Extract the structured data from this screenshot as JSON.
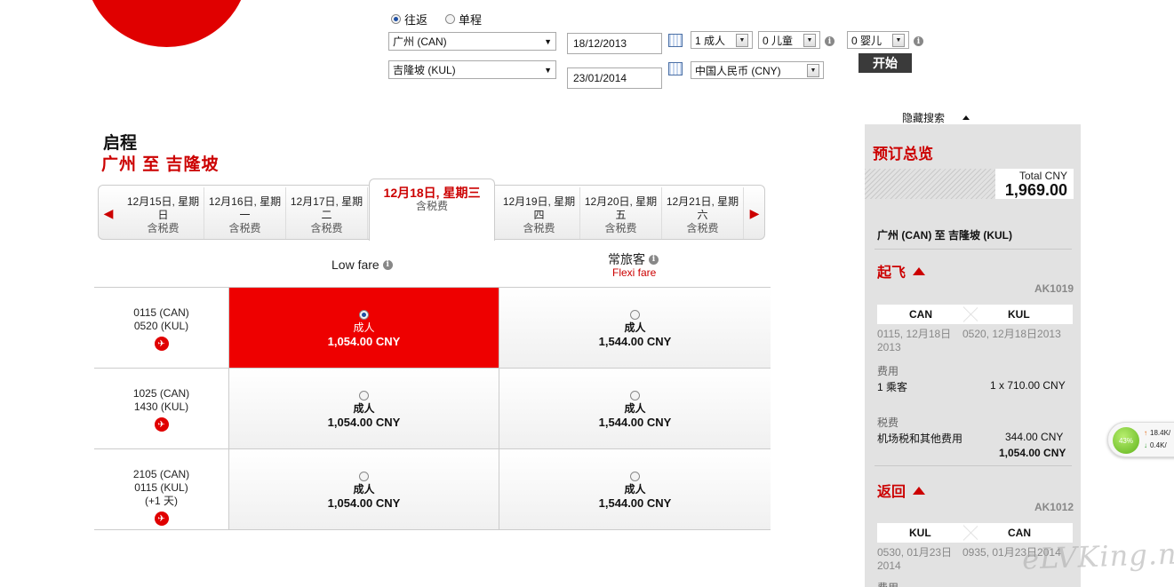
{
  "search": {
    "trip_types": [
      {
        "label": "往返",
        "selected": true
      },
      {
        "label": "单程",
        "selected": false
      }
    ],
    "origin": "广州 (CAN)",
    "destination": "吉隆坡 (KUL)",
    "depart_date": "18/12/2013",
    "return_date": "23/01/2014",
    "adults": "1 成人",
    "children": "0 儿童",
    "infants": "0 婴儿",
    "currency": "中国人民币 (CNY)",
    "go_label": "开始",
    "hide_search_label": "隐藏搜索"
  },
  "departure": {
    "heading": "启程",
    "route": "广州  至  吉隆坡",
    "date_tabs": [
      {
        "line1": "12月15日, 星期",
        "line2": "日",
        "sub": "含税费",
        "active": false
      },
      {
        "line1": "12月16日, 星期",
        "line2": "一",
        "sub": "含税费",
        "active": false
      },
      {
        "line1": "12月17日, 星期",
        "line2": "二",
        "sub": "含税费",
        "active": false
      },
      {
        "line1": "12月18日, 星期三",
        "line2": "",
        "sub": "含税费",
        "active": true
      },
      {
        "line1": "12月19日, 星期",
        "line2": "四",
        "sub": "含税费",
        "active": false
      },
      {
        "line1": "12月20日, 星期",
        "line2": "五",
        "sub": "含税费",
        "active": false
      },
      {
        "line1": "12月21日, 星期",
        "line2": "六",
        "sub": "含税费",
        "active": false
      }
    ],
    "fare_headers": {
      "low": "Low fare",
      "flexi": "常旅客",
      "flexi_sub": "Flexi fare"
    },
    "flights": [
      {
        "dep": "0115  (CAN)",
        "arr": "0520  (KUL)",
        "extra": "",
        "low_pax": "成人",
        "low_price": "1,054.00 CNY",
        "flexi_pax": "成人",
        "flexi_price": "1,544.00 CNY",
        "selected": "low"
      },
      {
        "dep": "1025  (CAN)",
        "arr": "1430  (KUL)",
        "extra": "",
        "low_pax": "成人",
        "low_price": "1,054.00 CNY",
        "flexi_pax": "成人",
        "flexi_price": "1,544.00 CNY",
        "selected": ""
      },
      {
        "dep": "2105  (CAN)",
        "arr": "0115  (KUL)",
        "extra": "(+1 天)",
        "low_pax": "成人",
        "low_price": "1,054.00 CNY",
        "flexi_pax": "成人",
        "flexi_price": "1,544.00 CNY",
        "selected": ""
      }
    ]
  },
  "summary": {
    "title": "预订总览",
    "total_label": "Total CNY",
    "total_value": "1,969.00",
    "route": "广州 (CAN) 至 吉隆坡 (KUL)",
    "outbound": {
      "title": "起飞",
      "flight_no": "AK1019",
      "from": "CAN",
      "to": "KUL",
      "from_time_1": "0115, 12月18日",
      "from_time_2": "2013",
      "to_time": "0520, 12月18日2013",
      "fee_label": "费用",
      "pax_text": "1 乘客",
      "pax_fare": "1 x 710.00 CNY",
      "tax_label": "税费",
      "tax_text": "机场税和其他费用",
      "tax_value": "344.00 CNY",
      "subtotal": "1,054.00 CNY"
    },
    "inbound": {
      "title": "返回",
      "flight_no": "AK1012",
      "from": "KUL",
      "to": "CAN",
      "from_time_1": "0530, 01月23日",
      "from_time_2": "2014",
      "to_time": "0935, 01月23日2014",
      "fee_label": "费用"
    }
  },
  "widget": {
    "percent": "43%",
    "up": "18.4K/",
    "down": "0.4K/"
  },
  "watermark": "eLVKing.net"
}
